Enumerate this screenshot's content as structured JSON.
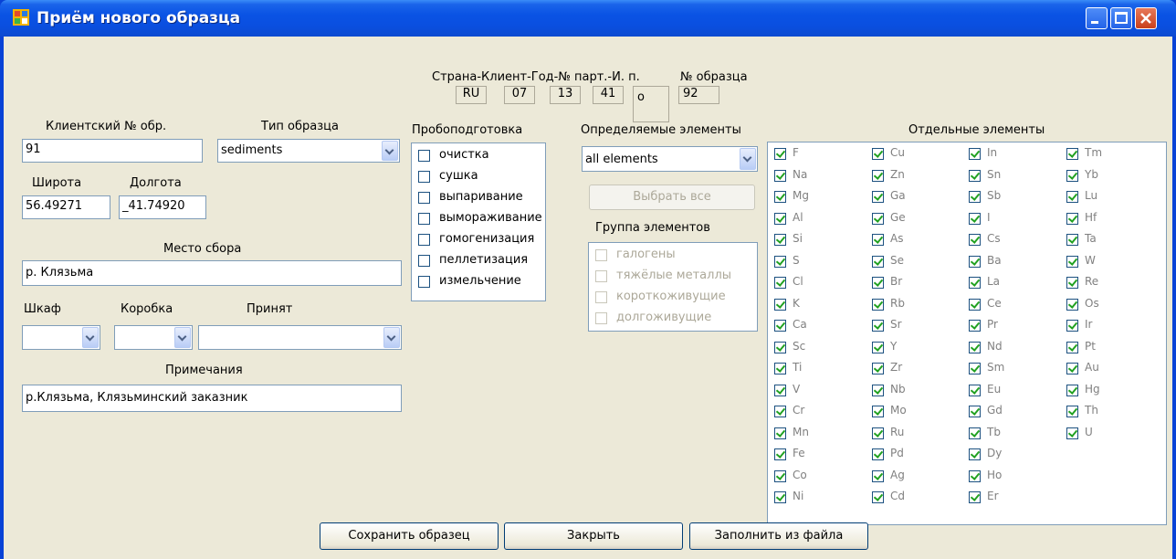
{
  "window": {
    "title": "Приём нового образца"
  },
  "code": {
    "header_label": "Страна-Клиент-Год-№ парт.-И. п.",
    "number_label": "№ образца",
    "country": "RU",
    "client": "07",
    "year": "13",
    "batch": "41",
    "source": "o",
    "sample_no": "92"
  },
  "client_sample": {
    "label": "Клиентский № обр.",
    "value": "91"
  },
  "sample_type": {
    "label": "Тип образца",
    "value": "sediments"
  },
  "latitude": {
    "label": "Широта",
    "value": "56.49271"
  },
  "longitude": {
    "label": "Долгота",
    "value": "_41.74920"
  },
  "place": {
    "label": "Место сбора",
    "value": "р. Клязьма"
  },
  "cabinet": {
    "label": "Шкаф",
    "value": ""
  },
  "box": {
    "label": "Коробка",
    "value": ""
  },
  "accepted": {
    "label": "Принят",
    "value": ""
  },
  "notes": {
    "label": "Примечания",
    "value": "р.Клязьма, Клязьминский заказник"
  },
  "prep": {
    "label": "Пробоподготовка",
    "items": [
      "очистка",
      "сушка",
      "выпаривание",
      "вымораживание",
      "гомогенизация",
      "пеллетизация",
      "измельчение"
    ]
  },
  "elements": {
    "label": "Определяемые элементы",
    "value": "all elements",
    "select_all": "Выбрать все",
    "group_label": "Группа элементов",
    "groups": [
      "галогены",
      "тяжёлые металлы",
      "короткоживущие",
      "долгоживущие"
    ]
  },
  "individual": {
    "label": "Отдельные элементы",
    "col1": [
      "F",
      "Na",
      "Mg",
      "Al",
      "Si",
      "S",
      "Cl",
      "K",
      "Ca",
      "Sc",
      "Ti",
      "V",
      "Cr",
      "Mn",
      "Fe",
      "Co",
      "Ni"
    ],
    "col2": [
      "Cu",
      "Zn",
      "Ga",
      "Ge",
      "As",
      "Se",
      "Br",
      "Rb",
      "Sr",
      "Y",
      "Zr",
      "Nb",
      "Mo",
      "Ru",
      "Pd",
      "Ag",
      "Cd"
    ],
    "col3": [
      "In",
      "Sn",
      "Sb",
      "I",
      "Cs",
      "Ba",
      "La",
      "Ce",
      "Pr",
      "Nd",
      "Sm",
      "Eu",
      "Gd",
      "Tb",
      "Dy",
      "Ho",
      "Er"
    ],
    "col4": [
      "Tm",
      "Yb",
      "Lu",
      "Hf",
      "Ta",
      "W",
      "Re",
      "Os",
      "Ir",
      "Pt",
      "Au",
      "Hg",
      "Th",
      "U"
    ]
  },
  "buttons": {
    "save": "Сохранить образец",
    "close": "Закрыть",
    "fill": "Заполнить из файла"
  }
}
